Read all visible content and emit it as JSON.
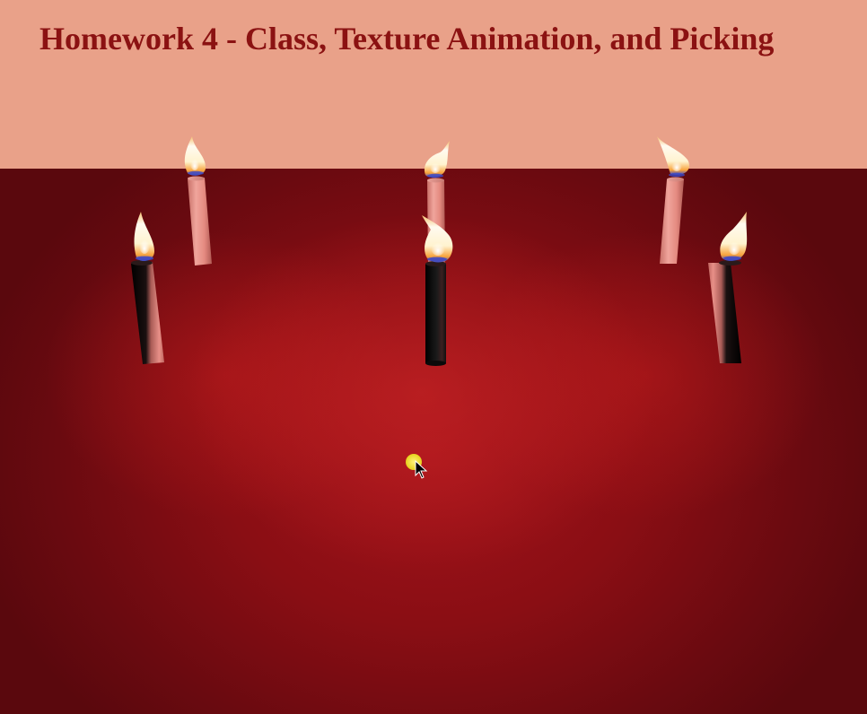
{
  "page": {
    "title": "Homework 4 - Class, Texture Animation, and Picking"
  },
  "colors": {
    "header_bg": "#e9a189",
    "title_text": "#8b1212",
    "table_cloth": "#a3131a",
    "candle_lit_black": "#111111",
    "candle_pink": "#e48a80",
    "flame_core": "#fff6d8",
    "flame_blue": "#3a48c8",
    "cursor_highlight": "#f3e53a"
  },
  "scene": {
    "candles": [
      {
        "name": "candle-back-left",
        "style": "pink",
        "flame_lean": "up"
      },
      {
        "name": "candle-back-center",
        "style": "pink",
        "flame_lean": "right"
      },
      {
        "name": "candle-back-right",
        "style": "pink",
        "flame_lean": "left"
      },
      {
        "name": "candle-front-left",
        "style": "black",
        "flame_lean": "up"
      },
      {
        "name": "candle-front-center",
        "style": "black",
        "flame_lean": "up"
      },
      {
        "name": "candle-front-right",
        "style": "black",
        "flame_lean": "right"
      }
    ],
    "cursor": {
      "icon": "pointer-arrow-icon",
      "highlight": "yellow-dot"
    }
  }
}
